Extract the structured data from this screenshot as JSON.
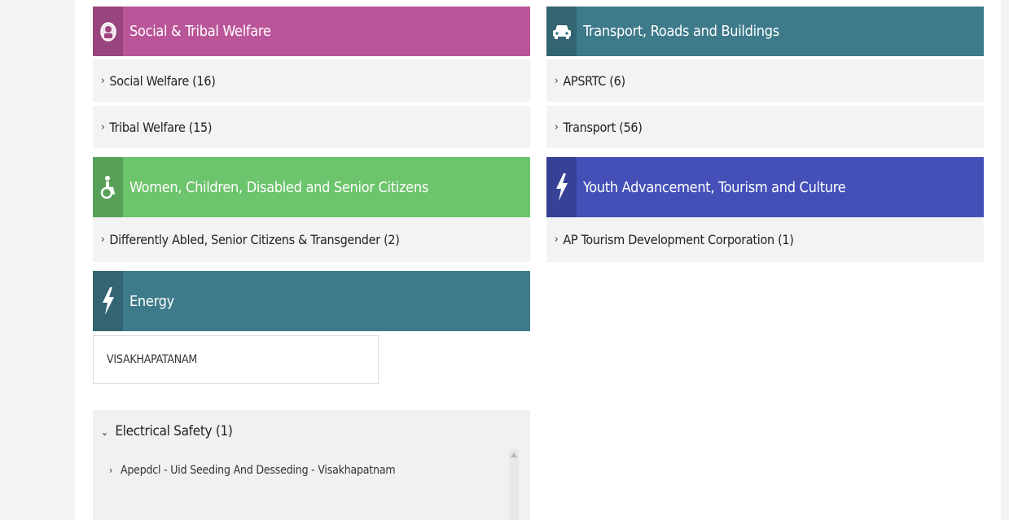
{
  "left": {
    "social": {
      "title": "Social & Tribal Welfare",
      "icon": "emblem-icon",
      "color": "#bb5599",
      "items": [
        "Social Welfare (16)",
        "Tribal Welfare (15)"
      ]
    },
    "women": {
      "title": "Women, Children, Disabled and Senior Citizens",
      "icon": "wheelchair-icon",
      "color": "#6cc46c",
      "items": [
        "Differently Abled, Senior Citizens & Transgender (2)"
      ]
    },
    "energy": {
      "title": "Energy",
      "icon": "lightning-icon",
      "color": "#3d7a8a",
      "district": "VISAKHAPATANAM",
      "subcategory": "Electrical Safety (1)",
      "service": "Apepdcl - Uid Seeding And Desseding - Visakhapatnam"
    }
  },
  "right": {
    "transport": {
      "title": "Transport, Roads and Buildings",
      "icon": "car-icon",
      "color": "#3d7a8a",
      "items": [
        "APSRTC (6)",
        "Transport (56)"
      ]
    },
    "youth": {
      "title": "Youth Advancement, Tourism and Culture",
      "icon": "lightning-icon",
      "color": "#4450b8",
      "items": [
        "AP Tourism Development Corporation (1)"
      ]
    }
  },
  "glyphs": {
    "chevron_right": "›",
    "chevron_down": "⌄"
  }
}
